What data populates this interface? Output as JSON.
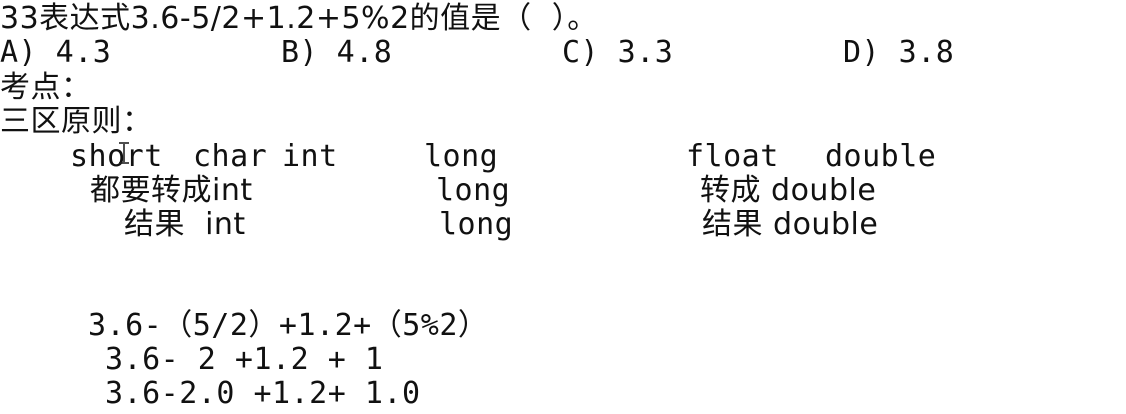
{
  "question": {
    "stem": "33表达式3.6-5/2+1.2+5%2的值是（  ）。",
    "options": [
      {
        "label": "A) 4.3"
      },
      {
        "label": "B) 4.8"
      },
      {
        "label": "C) 3.3"
      },
      {
        "label": "D) 3.8"
      }
    ]
  },
  "notes": {
    "kaodian": "考点：",
    "sanqu": "三区原则：",
    "row1": [
      "short",
      "char",
      "int",
      "long",
      "float",
      "double"
    ],
    "row2": [
      "都要转成int",
      "long",
      "转成 double"
    ],
    "row3": [
      "结果  int",
      "long",
      "结果 double"
    ]
  },
  "work": {
    "line1": "3.6-（5/2）+1.2+（5%2）",
    "line2": "3.6- 2 +1.2 + 1",
    "line3": "3.6-2.0 +1.2+ 1.0"
  }
}
